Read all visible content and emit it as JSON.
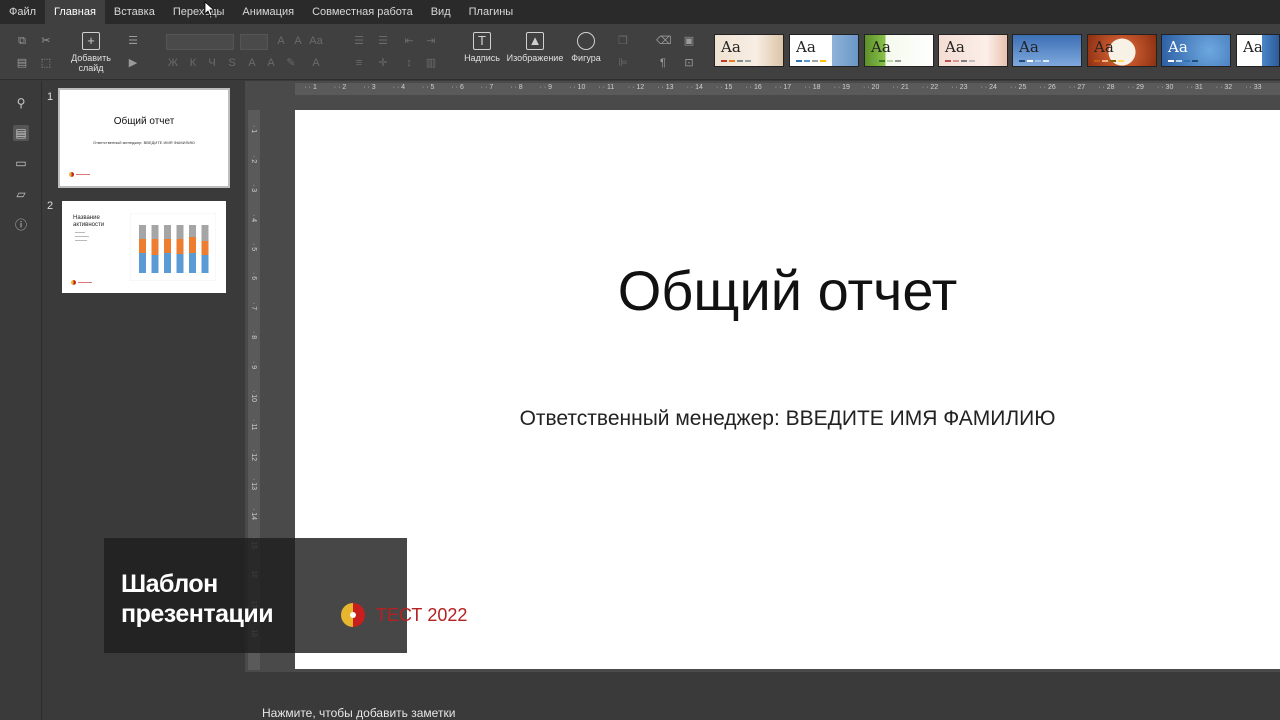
{
  "menu": {
    "items": [
      "Файл",
      "Главная",
      "Вставка",
      "Переходы",
      "Анимация",
      "Совместная работа",
      "Вид",
      "Плагины"
    ],
    "active_index": 1
  },
  "toolbar": {
    "add_slide_line1": "Добавить",
    "add_slide_line2": "слайд",
    "caption_label": "Надпись",
    "image_label": "Изображение",
    "shape_label": "Фигура",
    "theme_sample_text": "Aa"
  },
  "thumbnails": {
    "slide1": {
      "number": "1",
      "title": "Общий отчет",
      "subtitle": "Ответственный менеджер: ВВЕДИТЕ ИМЯ ФАМИЛИЮ"
    },
    "slide2": {
      "number": "2",
      "title_line1": "Название",
      "title_line2": "активности"
    }
  },
  "slide": {
    "title": "Общий отчет",
    "subtitle": "Ответственный менеджер: ВВЕДИТЕ ИМЯ ФАМИЛИЮ"
  },
  "notes": {
    "placeholder": "Нажмите, чтобы добавить заметки"
  },
  "overlay": {
    "line1": "Шаблон",
    "line2": "презентации",
    "brand_text": "ТЕСТ 2022"
  },
  "colors": {
    "accent_red": "#b52020",
    "logo_gold": "#e7b52e",
    "bar_blue": "#5b9bd5",
    "bar_orange": "#ed7d31",
    "bar_gray": "#a5a5a5"
  }
}
